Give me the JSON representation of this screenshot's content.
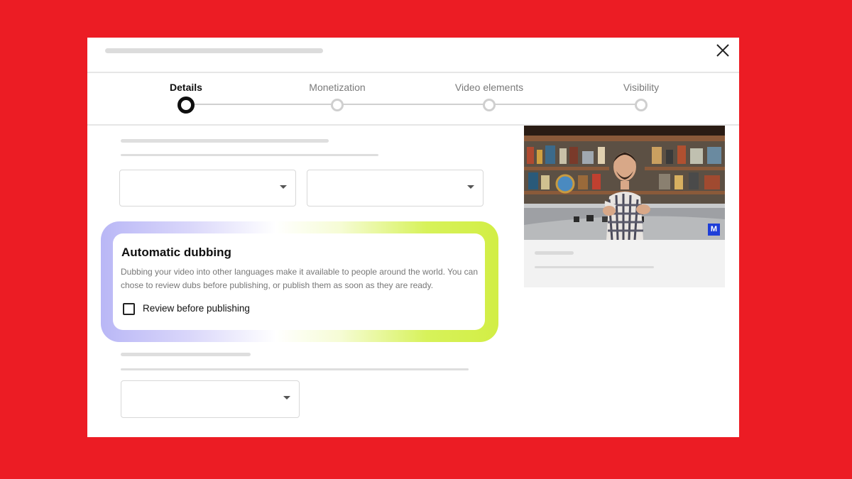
{
  "window": {
    "close_icon": "close-icon"
  },
  "stepper": {
    "steps": [
      {
        "label": "Details",
        "active": true
      },
      {
        "label": "Monetization",
        "active": false
      },
      {
        "label": "Video elements",
        "active": false
      },
      {
        "label": "Visibility",
        "active": false
      }
    ]
  },
  "dubbing": {
    "title": "Automatic dubbing",
    "description": "Dubbing your video into other languages make it available to people around the world. You can chose to review dubs before publishing, or publish them as soon as they are ready.",
    "checkbox_label": "Review before publishing",
    "checked": false
  },
  "preview": {
    "badge": "M",
    "thumbnail_subject": "man in plaid shirt in workshop"
  },
  "colors": {
    "background": "#ec1c24",
    "accent_purple": "#b9b7f6",
    "accent_lime": "#d2ee45",
    "badge_blue": "#1e3ed8"
  }
}
